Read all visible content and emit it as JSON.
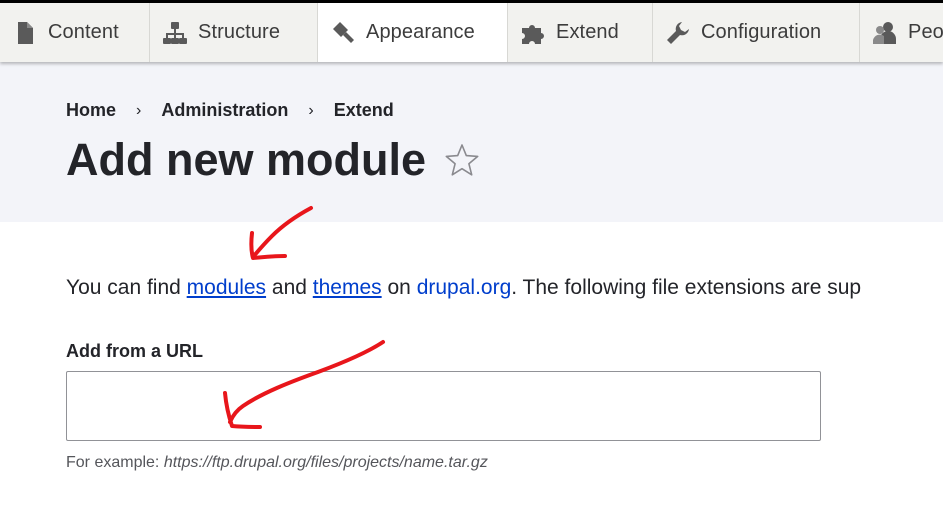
{
  "toolbar": {
    "tabs": [
      {
        "label": "Content",
        "icon": "file-icon"
      },
      {
        "label": "Structure",
        "icon": "sitemap-icon"
      },
      {
        "label": "Appearance",
        "icon": "paint-roller-icon"
      },
      {
        "label": "Extend",
        "icon": "puzzle-icon"
      },
      {
        "label": "Configuration",
        "icon": "wrench-icon"
      },
      {
        "label": "Peo",
        "icon": "people-icon"
      }
    ],
    "active_tab": "Appearance"
  },
  "breadcrumb": {
    "items": [
      "Home",
      "Administration",
      "Extend"
    ],
    "separator": "›"
  },
  "page": {
    "title": "Add new module",
    "favorite_icon": "star-outline-icon"
  },
  "intro": {
    "text_1": "You can find ",
    "link_modules": "modules",
    "text_2": " and ",
    "link_themes": "themes",
    "text_3": " on ",
    "link_drupal": "drupal.org",
    "text_4": ". The following file extensions are sup"
  },
  "url_field": {
    "label": "Add from a URL",
    "value": "",
    "placeholder": "",
    "description_prefix": "For example: ",
    "description_example": "https://ftp.drupal.org/files/projects/name.tar.gz"
  },
  "colors": {
    "link": "#003ecc",
    "header_bg": "#f3f4f9",
    "toolbar_bg": "#f2f2ef",
    "annotation": "#e8161b",
    "text": "#232429"
  }
}
